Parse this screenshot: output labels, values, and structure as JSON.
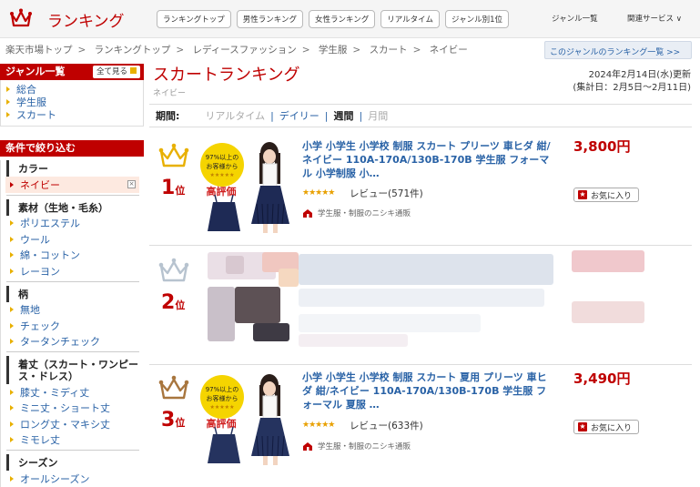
{
  "header": {
    "brand": "ランキング",
    "nav": [
      "ランキングトップ",
      "男性ランキング",
      "女性ランキング",
      "リアルタイム",
      "ジャンル別1位"
    ],
    "links": [
      "ジャンル一覧",
      "関連サービス ∨"
    ]
  },
  "breadcrumb": [
    "楽天市場トップ",
    "ランキングトップ",
    "レディースファッション",
    "学生服",
    "スカート",
    "ネイビー"
  ],
  "genre_rank_link": "このジャンルのランキング一覧 >>",
  "sidebar": {
    "genre_head": "ジャンル一覧",
    "see_all": "全て見る",
    "genres": [
      "総合",
      "学生服",
      "スカート"
    ],
    "filter_head": "条件で絞り込む",
    "groups": [
      {
        "title": "カラー",
        "items": [
          "ネイビー"
        ]
      },
      {
        "title": "素材（生地・毛糸）",
        "items": [
          "ポリエステル",
          "ウール",
          "綿・コットン",
          "レーヨン"
        ]
      },
      {
        "title": "柄",
        "items": [
          "無地",
          "チェック",
          "タータンチェック"
        ]
      },
      {
        "title": "着丈（スカート・ワンピース・ドレス）",
        "items": [
          "膝丈・ミディ丈",
          "ミニ丈・ショート丈",
          "ロング丈・マキシ丈",
          "ミモレ丈"
        ]
      },
      {
        "title": "シーズン",
        "items": [
          "オールシーズン"
        ]
      }
    ]
  },
  "main": {
    "title": "スカートランキング",
    "subtitle": "ネイビー",
    "updated": "2024年2月14日(水)更新",
    "period": "(集計日：2月5日～2月11日)",
    "period_label": "期間:",
    "periods": [
      "リアルタイム",
      "デイリー",
      "週間",
      "月間"
    ],
    "period_sep": "|"
  },
  "items": [
    {
      "rank": "1",
      "rank_suffix": "位",
      "title": "小学 小学生 小学校 制服 スカート プリーツ 車ヒダ 紺/ネイビー 110A-170A/130B-170B 学生服 フォーマル 小学制服 小…",
      "stars": "★★★★★",
      "review": "レビュー(571件)",
      "shop": "学生服・制服のニシキ通販",
      "price": "3,800円",
      "fav": "お気に入り",
      "thumb": {
        "line1": "97%以上の",
        "line2": "お客様から",
        "stars": "★★★★★",
        "badge": "高評価"
      }
    },
    {
      "rank": "2",
      "rank_suffix": "位"
    },
    {
      "rank": "3",
      "rank_suffix": "位",
      "title": "小学 小学生 小学校 制服 スカート 夏用 プリーツ 車ヒダ 紺/ネイビー 110A-170A/130B-170B 学生服 フォーマル 夏服 …",
      "stars": "★★★★★",
      "review": "レビュー(633件)",
      "shop": "学生服・制服のニシキ通販",
      "price": "3,490円",
      "fav": "お気に入り",
      "thumb": {
        "line1": "97%以上の",
        "line2": "お客様から",
        "stars": "★★★★★",
        "badge": "高評価"
      }
    }
  ],
  "colors": {
    "accent": "#bf0000",
    "link": "#2962a6",
    "gold": "#e8b000",
    "silver": "#b7c3cf",
    "bronze": "#a8763e"
  }
}
